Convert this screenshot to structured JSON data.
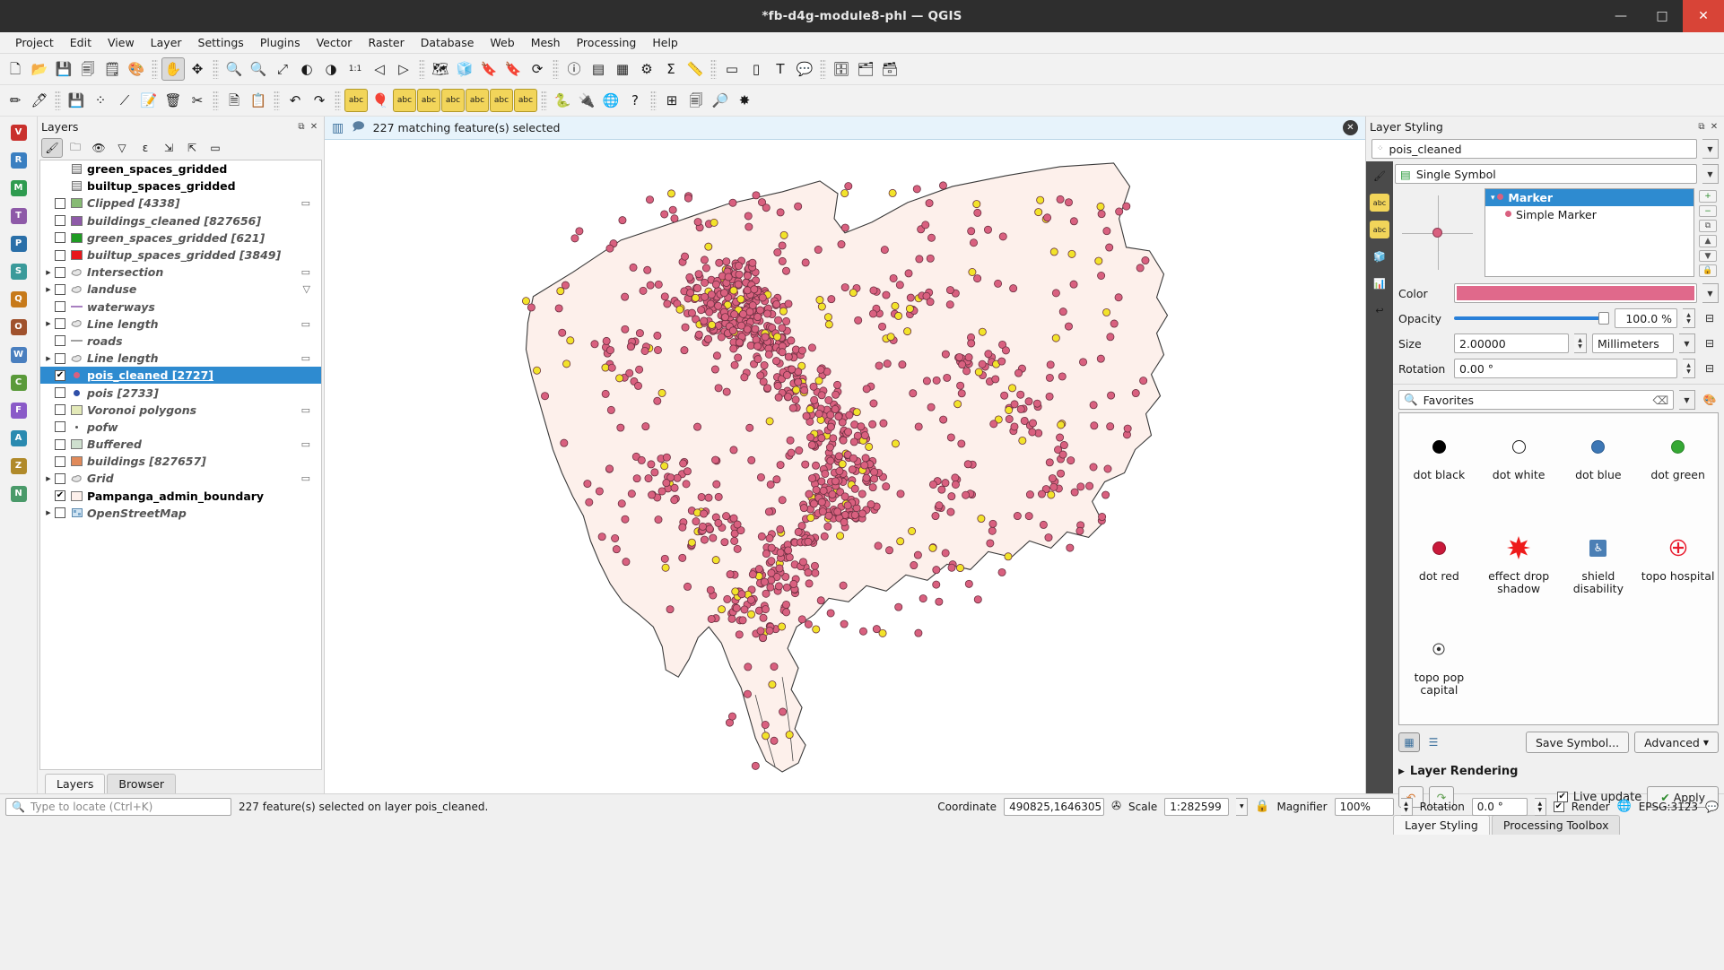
{
  "window": {
    "title": "*fb-d4g-module8-phl — QGIS",
    "minimize": "—",
    "maximize": "□",
    "close": "✕"
  },
  "menubar": {
    "items": [
      "Project",
      "Edit",
      "View",
      "Layer",
      "Settings",
      "Plugins",
      "Vector",
      "Raster",
      "Database",
      "Web",
      "Mesh",
      "Processing",
      "Help"
    ]
  },
  "toolbar1": [
    {
      "name": "new-project-icon",
      "glyph": "🗋"
    },
    {
      "name": "open-project-icon",
      "glyph": "📂"
    },
    {
      "name": "save-project-icon",
      "glyph": "💾"
    },
    {
      "name": "save-project-as-icon",
      "glyph": "🗐"
    },
    {
      "name": "new-print-layout-icon",
      "glyph": "🗒"
    },
    {
      "name": "style-manager-icon",
      "glyph": "🎨"
    },
    {
      "name": "pan-map-icon",
      "glyph": "✋",
      "active": true
    },
    {
      "name": "pan-to-selection-icon",
      "glyph": "✥"
    },
    {
      "name": "zoom-in-icon",
      "glyph": "🔍"
    },
    {
      "name": "zoom-out-icon",
      "glyph": "🔍"
    },
    {
      "name": "zoom-full-icon",
      "glyph": "⤢"
    },
    {
      "name": "zoom-to-selection-icon",
      "glyph": "◐"
    },
    {
      "name": "zoom-to-layer-icon",
      "glyph": "◑"
    },
    {
      "name": "zoom-native-icon",
      "glyph": "1:1"
    },
    {
      "name": "zoom-last-icon",
      "glyph": "◁"
    },
    {
      "name": "zoom-next-icon",
      "glyph": "▷"
    },
    {
      "name": "new-map-view-icon",
      "glyph": "🗺"
    },
    {
      "name": "new-3d-map-view-icon",
      "glyph": "🧊"
    },
    {
      "name": "show-bookmarks-icon",
      "glyph": "🔖"
    },
    {
      "name": "new-bookmark-icon",
      "glyph": "🔖"
    },
    {
      "name": "refresh-icon",
      "glyph": "⟳"
    },
    {
      "name": "identify-features-icon",
      "glyph": "ⓘ"
    },
    {
      "name": "attribute-table-icon",
      "glyph": "▤"
    },
    {
      "name": "field-calculator-icon",
      "glyph": "▦"
    },
    {
      "name": "options-icon",
      "glyph": "⚙"
    },
    {
      "name": "statistics-icon",
      "glyph": "Σ"
    },
    {
      "name": "measure-icon",
      "glyph": "📏"
    },
    {
      "name": "select-features-icon",
      "glyph": "▭"
    },
    {
      "name": "deselect-icon",
      "glyph": "▯"
    },
    {
      "name": "text-annotation-icon",
      "glyph": "T"
    },
    {
      "name": "map-tips-icon",
      "glyph": "💬"
    },
    {
      "name": "data-source-manager-icon",
      "glyph": "🗄"
    },
    {
      "name": "add-vector-layer-icon",
      "glyph": "🗂"
    },
    {
      "name": "add-delimited-text-icon",
      "glyph": "🗃"
    }
  ],
  "toolbar2": [
    {
      "name": "current-edits-icon",
      "glyph": "✏"
    },
    {
      "name": "toggle-editing-icon",
      "glyph": "🖊"
    },
    {
      "name": "save-layer-edits-icon",
      "glyph": "💾"
    },
    {
      "name": "add-point-feature-icon",
      "glyph": "⁘"
    },
    {
      "name": "vertex-tool-icon",
      "glyph": "⟋"
    },
    {
      "name": "modify-attributes-icon",
      "glyph": "📝"
    },
    {
      "name": "delete-selected-icon",
      "glyph": "🗑"
    },
    {
      "name": "cut-features-icon",
      "glyph": "✂"
    },
    {
      "name": "copy-features-icon",
      "glyph": "🗎"
    },
    {
      "name": "paste-features-icon",
      "glyph": "📋"
    },
    {
      "name": "undo-icon",
      "glyph": "↶"
    },
    {
      "name": "redo-icon",
      "glyph": "↷"
    },
    {
      "name": "label-toolbar-icon",
      "glyph": "abc"
    },
    {
      "name": "diagram-icon",
      "glyph": "🎈"
    },
    {
      "name": "highlight-pinned-labels-icon",
      "glyph": "abc"
    },
    {
      "name": "pin-labels-icon",
      "glyph": "abc"
    },
    {
      "name": "show-hide-labels-icon",
      "glyph": "abc"
    },
    {
      "name": "move-label-icon",
      "glyph": "abc"
    },
    {
      "name": "rotate-label-icon",
      "glyph": "abc"
    },
    {
      "name": "change-label-icon",
      "glyph": "abc"
    },
    {
      "name": "python-console-icon",
      "glyph": "🐍"
    },
    {
      "name": "plugin-manager-icon",
      "glyph": "🔌"
    },
    {
      "name": "browser-globe-icon",
      "glyph": "🌐"
    },
    {
      "name": "help-contents-icon",
      "glyph": "?"
    },
    {
      "name": "georeferencer-icon",
      "glyph": "⊞"
    },
    {
      "name": "print-layout-manager-icon",
      "glyph": "🗐"
    },
    {
      "name": "osm-place-search-icon",
      "glyph": "🔎"
    },
    {
      "name": "qneat3-icon",
      "glyph": "✸"
    }
  ],
  "leftrail": [
    {
      "name": "add-vector-layer-rail-icon",
      "glyph": "V"
    },
    {
      "name": "add-raster-layer-rail-icon",
      "glyph": "R"
    },
    {
      "name": "add-mesh-layer-rail-icon",
      "glyph": "M"
    },
    {
      "name": "add-delimited-text-rail-icon",
      "glyph": "T"
    },
    {
      "name": "add-postgis-rail-icon",
      "glyph": "P"
    },
    {
      "name": "add-spatialite-rail-icon",
      "glyph": "S"
    },
    {
      "name": "add-mssql-rail-icon",
      "glyph": "Q"
    },
    {
      "name": "add-oracle-rail-icon",
      "glyph": "O"
    },
    {
      "name": "add-wms-rail-icon",
      "glyph": "W"
    },
    {
      "name": "add-wcs-rail-icon",
      "glyph": "C"
    },
    {
      "name": "add-wfs-rail-icon",
      "glyph": "F"
    },
    {
      "name": "add-arcgis-rail-icon",
      "glyph": "A"
    },
    {
      "name": "add-vectortile-rail-icon",
      "glyph": "Z"
    },
    {
      "name": "new-shapefile-rail-icon",
      "glyph": "N"
    }
  ],
  "layers_panel": {
    "title": "Layers",
    "tools": [
      {
        "name": "open-layer-styling-panel-icon",
        "glyph": "🖌",
        "on": true
      },
      {
        "name": "add-group-icon",
        "glyph": "🗀"
      },
      {
        "name": "manage-map-themes-icon",
        "glyph": "👁"
      },
      {
        "name": "filter-legend-icon",
        "glyph": "▽"
      },
      {
        "name": "filter-legend-expression-icon",
        "glyph": "ε"
      },
      {
        "name": "expand-all-icon",
        "glyph": "⇲"
      },
      {
        "name": "collapse-all-icon",
        "glyph": "⇱"
      },
      {
        "name": "remove-layer-icon",
        "glyph": "▭"
      }
    ],
    "items": [
      {
        "name": "green_spaces_gridded",
        "checkbox": "none",
        "symbol": "table",
        "indent": 1,
        "style": "bold-black",
        "edit": false
      },
      {
        "name": "builtup_spaces_gridded",
        "checkbox": "none",
        "symbol": "table",
        "indent": 1,
        "style": "bold-black",
        "edit": false
      },
      {
        "name": "Clipped [4338]",
        "checkbox": "off",
        "symbol": "poly",
        "color": "#87bb74",
        "indent": 1,
        "style": "italic",
        "edit": true
      },
      {
        "name": "buildings_cleaned [827656]",
        "checkbox": "off",
        "symbol": "poly",
        "color": "#8e5aa8",
        "indent": 1,
        "style": "italic",
        "edit": false
      },
      {
        "name": "green_spaces_gridded [621]",
        "checkbox": "off",
        "symbol": "poly",
        "color": "#1f9b23",
        "indent": 1,
        "style": "italic",
        "edit": false
      },
      {
        "name": "builtup_spaces_gridded [3849]",
        "checkbox": "off",
        "symbol": "poly",
        "color": "#e8161b",
        "indent": 1,
        "style": "italic",
        "edit": false
      },
      {
        "name": "Intersection",
        "checkbox": "off",
        "symbol": "blob",
        "indent": 0,
        "style": "italic",
        "edit": true
      },
      {
        "name": "landuse",
        "checkbox": "off",
        "symbol": "blob",
        "indent": 0,
        "style": "italic",
        "edit": "filter"
      },
      {
        "name": "waterways",
        "checkbox": "off",
        "symbol": "line",
        "color": "#a87fc0",
        "indent": 1,
        "style": "italic",
        "edit": false
      },
      {
        "name": "Line length",
        "checkbox": "off",
        "symbol": "blob",
        "indent": 0,
        "style": "italic",
        "edit": true
      },
      {
        "name": "roads",
        "checkbox": "off",
        "symbol": "line",
        "color": "#a0a0a0",
        "indent": 1,
        "style": "italic",
        "edit": false
      },
      {
        "name": "Line length",
        "checkbox": "off",
        "symbol": "blob",
        "indent": 0,
        "style": "italic",
        "edit": true
      },
      {
        "name": "pois_cleaned [2727]",
        "checkbox": "on",
        "symbol": "dot",
        "color": "#d9607f",
        "indent": 1,
        "style": "selected",
        "edit": false
      },
      {
        "name": "pois [2733]",
        "checkbox": "off",
        "symbol": "dot",
        "color": "#2f4fa8",
        "indent": 1,
        "style": "italic",
        "edit": false
      },
      {
        "name": "Voronoi polygons",
        "checkbox": "off",
        "symbol": "poly",
        "color": "#e3e9b8",
        "indent": 1,
        "style": "italic",
        "edit": true
      },
      {
        "name": "pofw",
        "checkbox": "off",
        "symbol": "tinydot",
        "color": "#555555",
        "indent": 1,
        "style": "italic",
        "edit": false
      },
      {
        "name": "Buffered",
        "checkbox": "off",
        "symbol": "poly",
        "color": "#cfe0cf",
        "indent": 1,
        "style": "italic",
        "edit": true
      },
      {
        "name": "buildings [827657]",
        "checkbox": "off",
        "symbol": "poly",
        "color": "#e08a5a",
        "indent": 1,
        "style": "italic",
        "edit": false
      },
      {
        "name": "Grid",
        "checkbox": "off",
        "symbol": "blob",
        "indent": 0,
        "style": "italic",
        "edit": true
      },
      {
        "name": "Pampanga_admin_boundary",
        "checkbox": "on",
        "symbol": "poly",
        "color": "#fdf0eb",
        "indent": 1,
        "style": "bold-black",
        "edit": false
      },
      {
        "name": "OpenStreetMap",
        "checkbox": "off",
        "symbol": "raster",
        "indent": 0,
        "style": "italic",
        "edit": false
      }
    ],
    "tabs": [
      {
        "label": "Layers",
        "active": true
      },
      {
        "label": "Browser",
        "active": false
      }
    ]
  },
  "message_bar": {
    "text": "227 matching feature(s) selected",
    "left_icon": "table-icon",
    "comment_icon": "speech-icon",
    "close": "✕"
  },
  "styling_panel": {
    "title": "Layer Styling",
    "layer_name": "pois_cleaned",
    "renderer": "Single Symbol",
    "symbol_tree": [
      {
        "label": "Marker",
        "selected": true,
        "indent": 0
      },
      {
        "label": "Simple Marker",
        "selected": false,
        "indent": 1
      }
    ],
    "side_tabs": [
      {
        "name": "symbology-tab-icon",
        "glyph": "🖌"
      },
      {
        "name": "labels-tab-icon",
        "glyph": "abc"
      },
      {
        "name": "masks-tab-icon",
        "glyph": "abc"
      },
      {
        "name": "3d-view-tab-icon",
        "glyph": "🧊"
      },
      {
        "name": "diagrams-tab-icon",
        "glyph": "📊"
      },
      {
        "name": "history-tab-icon",
        "glyph": "↩"
      }
    ],
    "tree_buttons": [
      {
        "name": "add-symbol-layer-button",
        "glyph": "+"
      },
      {
        "name": "remove-symbol-layer-button",
        "glyph": "−"
      },
      {
        "name": "duplicate-symbol-layer-button",
        "glyph": "⧉"
      },
      {
        "name": "move-up-button",
        "glyph": "▲"
      },
      {
        "name": "move-down-button",
        "glyph": "▼"
      },
      {
        "name": "lock-colors-button",
        "glyph": "🔒"
      }
    ],
    "color_label": "Color",
    "color_value": "#e0698b",
    "opacity_label": "Opacity",
    "opacity_value": "100.0 %",
    "size_label": "Size",
    "size_value": "2.00000",
    "size_unit": "Millimeters",
    "rotation_label": "Rotation",
    "rotation_value": "0.00 °",
    "search_value": "Favorites",
    "gallery": [
      {
        "label": "dot  black",
        "icon": "dot",
        "color": "#000000",
        "stroke": "#000000"
      },
      {
        "label": "dot  white",
        "icon": "dot",
        "color": "#ffffff",
        "stroke": "#1a1a1a"
      },
      {
        "label": "dot blue",
        "icon": "dot",
        "color": "#3d77b5",
        "stroke": "#2a5b90"
      },
      {
        "label": "dot green",
        "icon": "dot",
        "color": "#35a834",
        "stroke": "#2a8429"
      },
      {
        "label": "dot red",
        "icon": "dot",
        "color": "#c9193a",
        "stroke": "#8f1029"
      },
      {
        "label": "effect drop shadow",
        "icon": "star",
        "color": "#ee1b1b",
        "stroke": "#cc1010"
      },
      {
        "label": "shield disability",
        "icon": "shield",
        "color": "#4b7fb5",
        "stroke": "#3b679a"
      },
      {
        "label": "topo hospital",
        "icon": "cross",
        "color": "#e8192c",
        "stroke": "#e8192c"
      },
      {
        "label": "topo pop capital",
        "icon": "target",
        "color": "#333333",
        "stroke": "#333333"
      }
    ],
    "view_buttons": [
      {
        "name": "icon-view-button",
        "glyph": "▦",
        "on": true
      },
      {
        "name": "list-view-button",
        "glyph": "☰",
        "on": false
      }
    ],
    "save_symbol_label": "Save Symbol...",
    "advanced_label": "Advanced",
    "layer_rendering_label": "Layer Rendering",
    "undo_label": "↶",
    "redo_label": "↷",
    "live_update_label": "Live update",
    "apply_label": "Apply",
    "bottom_tabs": [
      {
        "label": "Layer Styling",
        "active": true
      },
      {
        "label": "Processing Toolbox",
        "active": false
      }
    ]
  },
  "statusbar": {
    "locate_placeholder": "Type to locate (Ctrl+K)",
    "status_message": "227 feature(s) selected on layer pois_cleaned.",
    "coordinate_label": "Coordinate",
    "coordinate_value": "490825,1646305",
    "scale_label": "Scale",
    "scale_value": "1:282599",
    "magnifier_label": "Magnifier",
    "magnifier_value": "100%",
    "rotation_label": "Rotation",
    "rotation_value": "0.0 °",
    "render_label": "Render",
    "crs_label": "EPSG:3123",
    "messages_icon": "💬"
  },
  "map": {
    "boundary_fill": "#fdf0eb",
    "boundary_stroke": "#3a3a3a",
    "point_pink": "#d9607f",
    "point_yellow": "#f2e32a",
    "point_stroke": "#6b3040"
  }
}
